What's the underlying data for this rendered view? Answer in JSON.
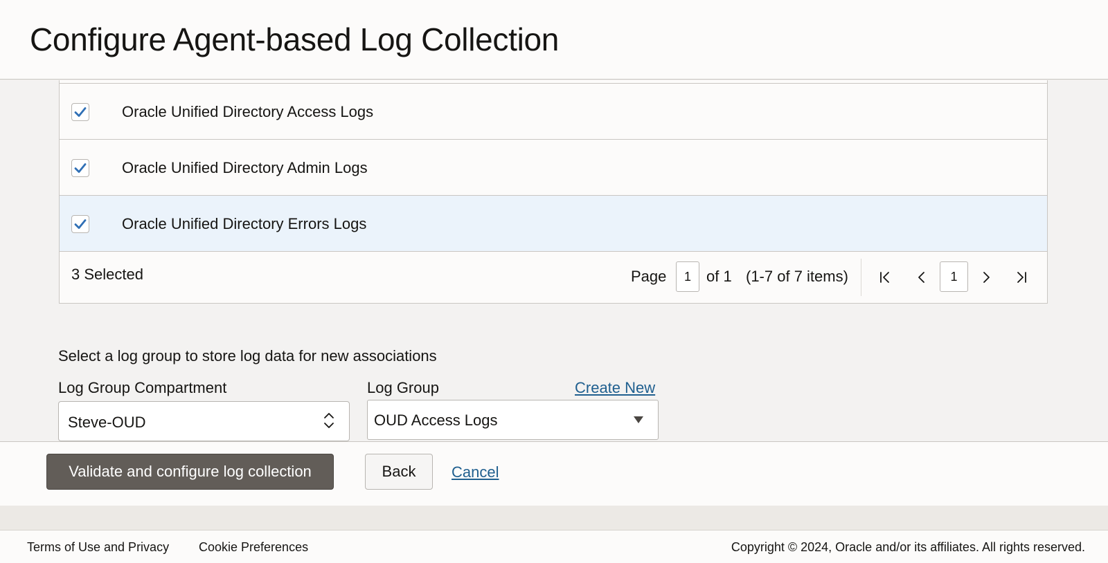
{
  "header": {
    "title": "Configure Agent-based Log Collection"
  },
  "table": {
    "rows": [
      {
        "label": "Oracle Unified Directory Access Logs",
        "checked": true
      },
      {
        "label": "Oracle Unified Directory Admin Logs",
        "checked": true
      },
      {
        "label": "Oracle Unified Directory Errors Logs",
        "checked": true,
        "highlighted": true
      }
    ],
    "selected_count": "3 Selected",
    "pagination": {
      "page_label": "Page",
      "page_value": "1",
      "of_label": "of 1",
      "items_label": "(1-7 of 7 items)",
      "current_page": "1"
    }
  },
  "log_group": {
    "instruction": "Select a log group to store log data for new associations",
    "compartment_label": "Log Group Compartment",
    "compartment_value": "Steve-OUD",
    "group_label": "Log Group",
    "create_new": "Create New",
    "group_value": "OUD Access Logs"
  },
  "actions": {
    "validate": "Validate and configure log collection",
    "back": "Back",
    "cancel": "Cancel"
  },
  "footer": {
    "terms": "Terms of Use and Privacy",
    "cookies": "Cookie Preferences",
    "copyright": "Copyright © 2024, Oracle and/or its affiliates. All rights reserved."
  },
  "icons": {
    "checkbox_check": "check-icon",
    "first_page": "first-page-icon",
    "prev_page": "chevron-left-icon",
    "next_page": "chevron-right-icon",
    "last_page": "last-page-icon",
    "help": "lifebuoy-icon",
    "apps": "grid-icon"
  },
  "colors": {
    "primary_button": "#625d58",
    "link": "#1f5f8f",
    "selected_row": "#ebf3fb",
    "check": "#2f6fb5"
  }
}
